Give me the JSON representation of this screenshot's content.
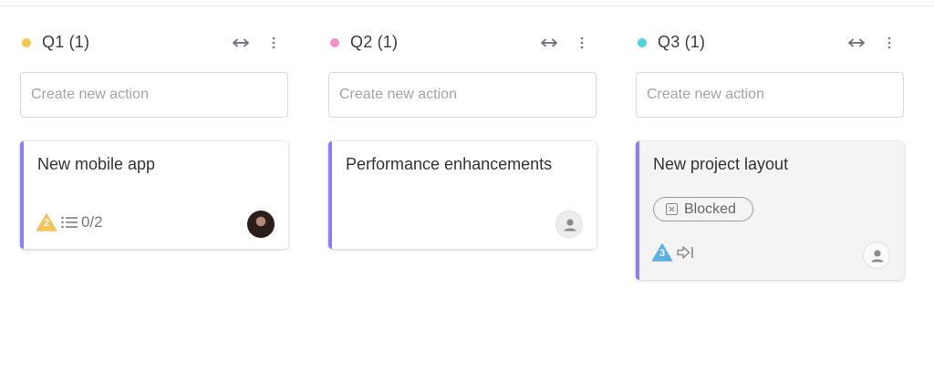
{
  "columns": [
    {
      "title": "Q1 (1)",
      "dot_color": "#f5c84b",
      "create_placeholder": "Create new action",
      "card": {
        "title": "New mobile app",
        "priority": "2",
        "priority_color": "#f3c25d",
        "checklist": "0/2",
        "assignee": "avatar-photo"
      }
    },
    {
      "title": "Q2 (1)",
      "dot_color": "#f58fc8",
      "create_placeholder": "Create new action",
      "card": {
        "title": "Performance enhancements",
        "assignee": "person-icon"
      }
    },
    {
      "title": "Q3 (1)",
      "dot_color": "#4fd1dc",
      "create_placeholder": "Create new action",
      "card": {
        "title": "New project layout",
        "tag": "Blocked",
        "priority": "3",
        "priority_color": "#5ab0e0",
        "dependency_icon": "arrow-into-bar-icon",
        "assignee": "person-icon"
      }
    }
  ],
  "colors": {
    "card_accent": "#8a7ef2",
    "icon_gray": "#8a8a8a"
  }
}
